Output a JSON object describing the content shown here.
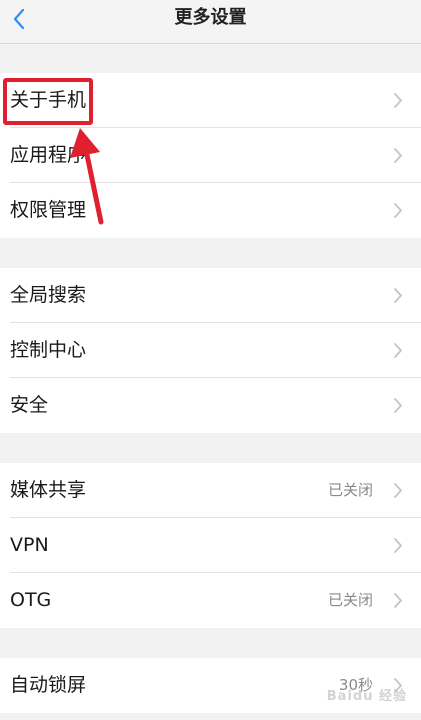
{
  "header": {
    "title": "更多设置"
  },
  "groups": [
    {
      "items": [
        {
          "label": "关于手机",
          "status": ""
        },
        {
          "label": "应用程序",
          "status": ""
        },
        {
          "label": "权限管理",
          "status": ""
        }
      ]
    },
    {
      "items": [
        {
          "label": "全局搜索",
          "status": ""
        },
        {
          "label": "控制中心",
          "status": ""
        },
        {
          "label": "安全",
          "status": ""
        }
      ]
    },
    {
      "items": [
        {
          "label": "媒体共享",
          "status": "已关闭"
        },
        {
          "label": "VPN",
          "status": ""
        },
        {
          "label": "OTG",
          "status": "已关闭"
        }
      ]
    },
    {
      "items": [
        {
          "label": "自动锁屏",
          "status": "30秒"
        }
      ]
    }
  ],
  "watermark": "Baidu 经验",
  "colors": {
    "accent": "#2f8cf0",
    "annotation": "#e0202e"
  },
  "icons": {
    "back": "chevron-left-icon",
    "row": "chevron-right-icon"
  }
}
